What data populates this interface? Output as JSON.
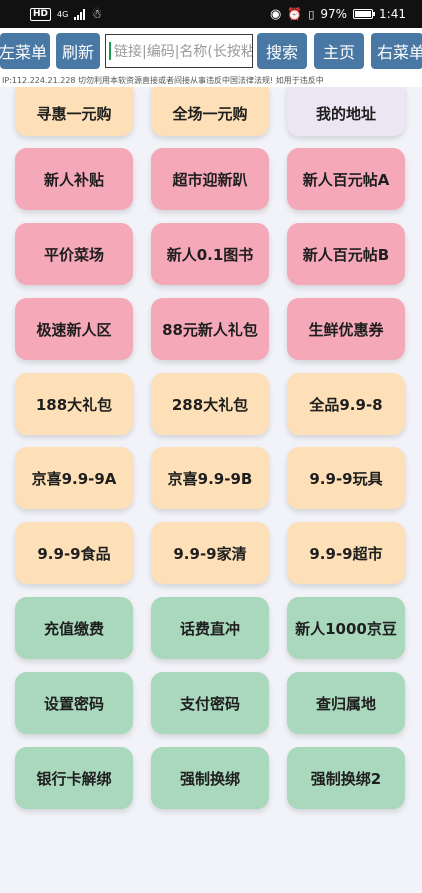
{
  "status": {
    "hd": "HD",
    "network": "4G",
    "battery": "97%",
    "battery_level": 0.97,
    "time": "1:41"
  },
  "toolbar": {
    "left_menu": "左菜单",
    "refresh": "刷新",
    "search_placeholder": "链接|编码|名称(长按粘",
    "search": "搜索",
    "home": "主页",
    "right_menu": "右菜单"
  },
  "ticker": "IP:112.224.21.228    切勿利用本软资源直接或者间接从事违反中国法律法规! 如用于违反中",
  "colors": {
    "orange": "#fde0b8",
    "lavender": "#ece6f4",
    "pink": "#f4a8b8",
    "green": "#a9d8bc",
    "button": "#4a78a4"
  },
  "tiles": [
    {
      "label": "寻惠一元购",
      "color": "orange"
    },
    {
      "label": "全场一元购",
      "color": "orange"
    },
    {
      "label": "我的地址",
      "color": "lavender"
    },
    {
      "label": "新人补贴",
      "color": "pink"
    },
    {
      "label": "超市迎新趴",
      "color": "pink"
    },
    {
      "label": "新人百元帖A",
      "color": "pink"
    },
    {
      "label": "平价菜场",
      "color": "pink"
    },
    {
      "label": "新人0.1图书",
      "color": "pink"
    },
    {
      "label": "新人百元帖B",
      "color": "pink"
    },
    {
      "label": "极速新人区",
      "color": "pink"
    },
    {
      "label": "88元新人礼包",
      "color": "pink"
    },
    {
      "label": "生鲜优惠券",
      "color": "pink"
    },
    {
      "label": "188大礼包",
      "color": "orange"
    },
    {
      "label": "288大礼包",
      "color": "orange"
    },
    {
      "label": "全品9.9-8",
      "color": "orange"
    },
    {
      "label": "京喜9.9-9A",
      "color": "orange"
    },
    {
      "label": "京喜9.9-9B",
      "color": "orange"
    },
    {
      "label": "9.9-9玩具",
      "color": "orange"
    },
    {
      "label": "9.9-9食品",
      "color": "orange"
    },
    {
      "label": "9.9-9家清",
      "color": "orange"
    },
    {
      "label": "9.9-9超市",
      "color": "orange"
    },
    {
      "label": "充值缴费",
      "color": "green"
    },
    {
      "label": "话费直冲",
      "color": "green"
    },
    {
      "label": "新人1000京豆",
      "color": "green"
    },
    {
      "label": "设置密码",
      "color": "green"
    },
    {
      "label": "支付密码",
      "color": "green"
    },
    {
      "label": "查归属地",
      "color": "green"
    },
    {
      "label": "银行卡解绑",
      "color": "green"
    },
    {
      "label": "强制换绑",
      "color": "green"
    },
    {
      "label": "强制换绑2",
      "color": "green"
    }
  ]
}
